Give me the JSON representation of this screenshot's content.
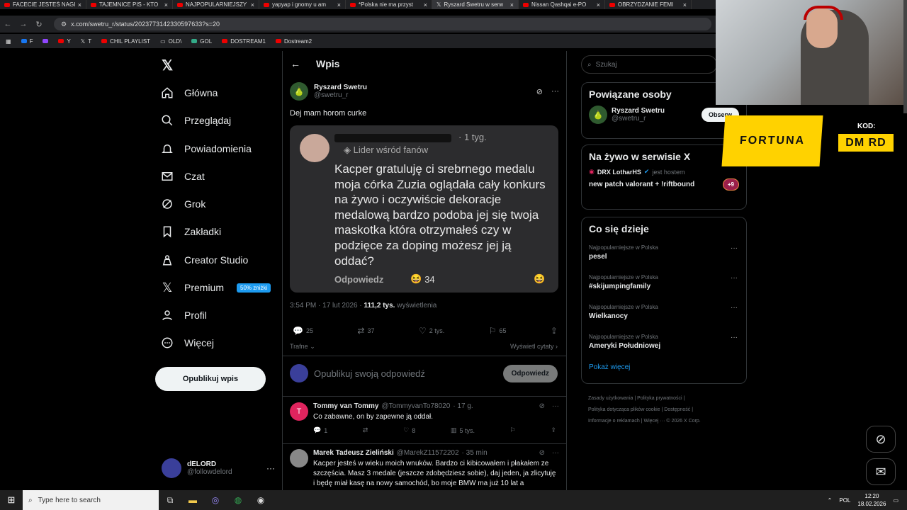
{
  "browser": {
    "tabs": [
      {
        "title": "FACECIE JESTEŚ NAGI"
      },
      {
        "title": "TAJEMNICE PIS - KTO"
      },
      {
        "title": "NAJPOPULARNIEJSZY"
      },
      {
        "title": "yapyap i gnomy u am"
      },
      {
        "title": "*Polska nie ma przyst"
      },
      {
        "title": "Ryszard Swetru w serw"
      },
      {
        "title": "Nissan Qashqai e-PO"
      },
      {
        "title": "OBRZYDZANIE FEMI"
      }
    ],
    "url": "x.com/swetru_r/status/2023773142330597633?s=20",
    "bookmarks": [
      "F",
      "",
      "Y",
      "T",
      "CHIL PLAYLIST",
      "OLD\\",
      "GOL",
      "DOSTREAM1",
      "Dostream2"
    ]
  },
  "nav": {
    "items": [
      {
        "label": "Główna",
        "icon": "home-icon"
      },
      {
        "label": "Przeglądaj",
        "icon": "search-icon"
      },
      {
        "label": "Powiadomienia",
        "icon": "bell-icon"
      },
      {
        "label": "Czat",
        "icon": "mail-icon"
      },
      {
        "label": "Grok",
        "icon": "grok-icon"
      },
      {
        "label": "Zakładki",
        "icon": "bookmark-icon"
      },
      {
        "label": "Creator Studio",
        "icon": "creator-icon"
      },
      {
        "label": "Premium",
        "icon": "x-icon"
      },
      {
        "label": "Profil",
        "icon": "user-icon"
      },
      {
        "label": "Więcej",
        "icon": "more-icon"
      }
    ],
    "premium_badge": "50% zniżki",
    "post_button": "Opublikuj wpis",
    "account": {
      "name": "dELORD",
      "handle": "@followdelord"
    }
  },
  "post": {
    "header": "Wpis",
    "author_name": "Ryszard Swetru",
    "author_handle": "@swetru_r",
    "text": "Dej mam horom curke",
    "screenshot": {
      "time": "· 1 tyg.",
      "fan_label": "Lider wśród fanów",
      "body": "Kacper gratuluję ci srebrnego medalu moja córka Zuzia oglądała cały konkurs na żywo i oczywiście dekoracje medalową bardzo podoba jej się twoja maskotka która otrzymałeś czy w podzięce za doping możesz jej ją oddać?",
      "reply": "Odpowiedz",
      "reaction_count": "34"
    },
    "time": "3:54 PM · 17 lut 2026 ·",
    "views": "111,2 tys.",
    "views_label": "wyświetlenia",
    "stats": {
      "replies": "25",
      "reposts": "37",
      "likes": "2 tys.",
      "bookmarks": "65"
    },
    "sort": "Trafne",
    "quotes": "Wyświetl cytaty",
    "reply_placeholder": "Opublikuj swoją odpowiedź",
    "reply_button": "Odpowiedz"
  },
  "replies": [
    {
      "name": "Tommy van Tommy",
      "handle": "@TommyvanTo78020",
      "time": "· 17 g.",
      "text": "Co zabawne, on by zapewne ją oddał.",
      "replies": "1",
      "reposts": "",
      "likes": "8",
      "views": "5 tys.",
      "avatar_letter": "T"
    },
    {
      "name": "Marek Tadeusz Zieliński",
      "handle": "@MarekZ11572202",
      "time": "· 35 min",
      "text": "Kacper jesteś w wieku moich wnuków. Bardzo ci kibicowałem i płakałem ze szczęścia. Masz 3 medale (jeszcze zdobędziesz sobie), daj jeden, ja zlicytuję i będę miał kasę na nowy samochód, bo moje BMW ma już 10 lat a",
      "avatar_letter": ""
    }
  ],
  "right": {
    "search_placeholder": "Szukaj",
    "related_title": "Powiązane osoby",
    "related_person": {
      "name": "Ryszard Swetru",
      "handle": "@swetru_r",
      "button": "Obserw"
    },
    "live_title": "Na żywo w serwisie X",
    "live_host": "DRX LotharHS",
    "live_host_suffix": "jest hostem",
    "live_stream": "new patch valorant + !riftbound",
    "live_extra": "+9",
    "trends_title": "Co się dzieje",
    "trends": [
      {
        "context": "Najpopularniejsze w Polska",
        "name": "pesel"
      },
      {
        "context": "Najpopularniejsze w Polska",
        "name": "#skijumpingfamily"
      },
      {
        "context": "Najpopularniejsze w Polska",
        "name": "Wielkanocy"
      },
      {
        "context": "Najpopularniejsze w Polska",
        "name": "Ameryki Południowej"
      }
    ],
    "show_more": "Pokaż więcej",
    "footer": [
      "Zasady użytkowania",
      "Polityka prywatności",
      "Polityka dotycząca plików cookie",
      "Dostępność",
      "Informacje o reklamach",
      "Więcej ···",
      "© 2026 X Corp."
    ]
  },
  "overlay": {
    "sponsor": "FORTUNA",
    "code_label": "KOD:",
    "code": "DM RD"
  },
  "taskbar": {
    "search": "Type here to search",
    "lang": "POL",
    "time": "12:20",
    "date": "18.02.2026"
  },
  "colors": {
    "accent": "#1d9bf0",
    "background": "#000000",
    "sponsor": "#ffd200"
  }
}
